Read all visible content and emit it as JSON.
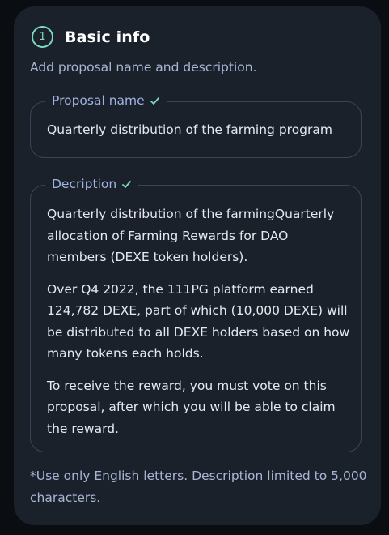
{
  "section": {
    "step_number": "1",
    "title": "Basic info",
    "subtitle": "Add proposal name and description."
  },
  "proposal_name": {
    "label": "Proposal name",
    "value": "Quarterly distribution of the farming program",
    "valid": true
  },
  "description": {
    "label": "Decription",
    "valid": true,
    "paragraphs": [
      "Quarterly distribution of the farmingQuarterly allocation of Farming Rewards for DAO members (DEXE token holders).",
      "Over Q4 2022, the 111PG platform earned 124,782 DEXE, part of which (10,000 DEXE) will be distributed to all DEXE holders based on how many tokens each holds.",
      "To receive the reward, you must vote on this proposal, after which you will be able to claim the reward."
    ]
  },
  "footnote": "*Use only English letters. Description limited to 5,000 characters.",
  "colors": {
    "accent": "#7fd8c1",
    "card_bg": "#1b212b",
    "page_bg": "#0a0d12",
    "label": "#9fb3e0",
    "muted": "#a8b6d6",
    "text": "#e6e9ef",
    "border": "#3a4557"
  }
}
